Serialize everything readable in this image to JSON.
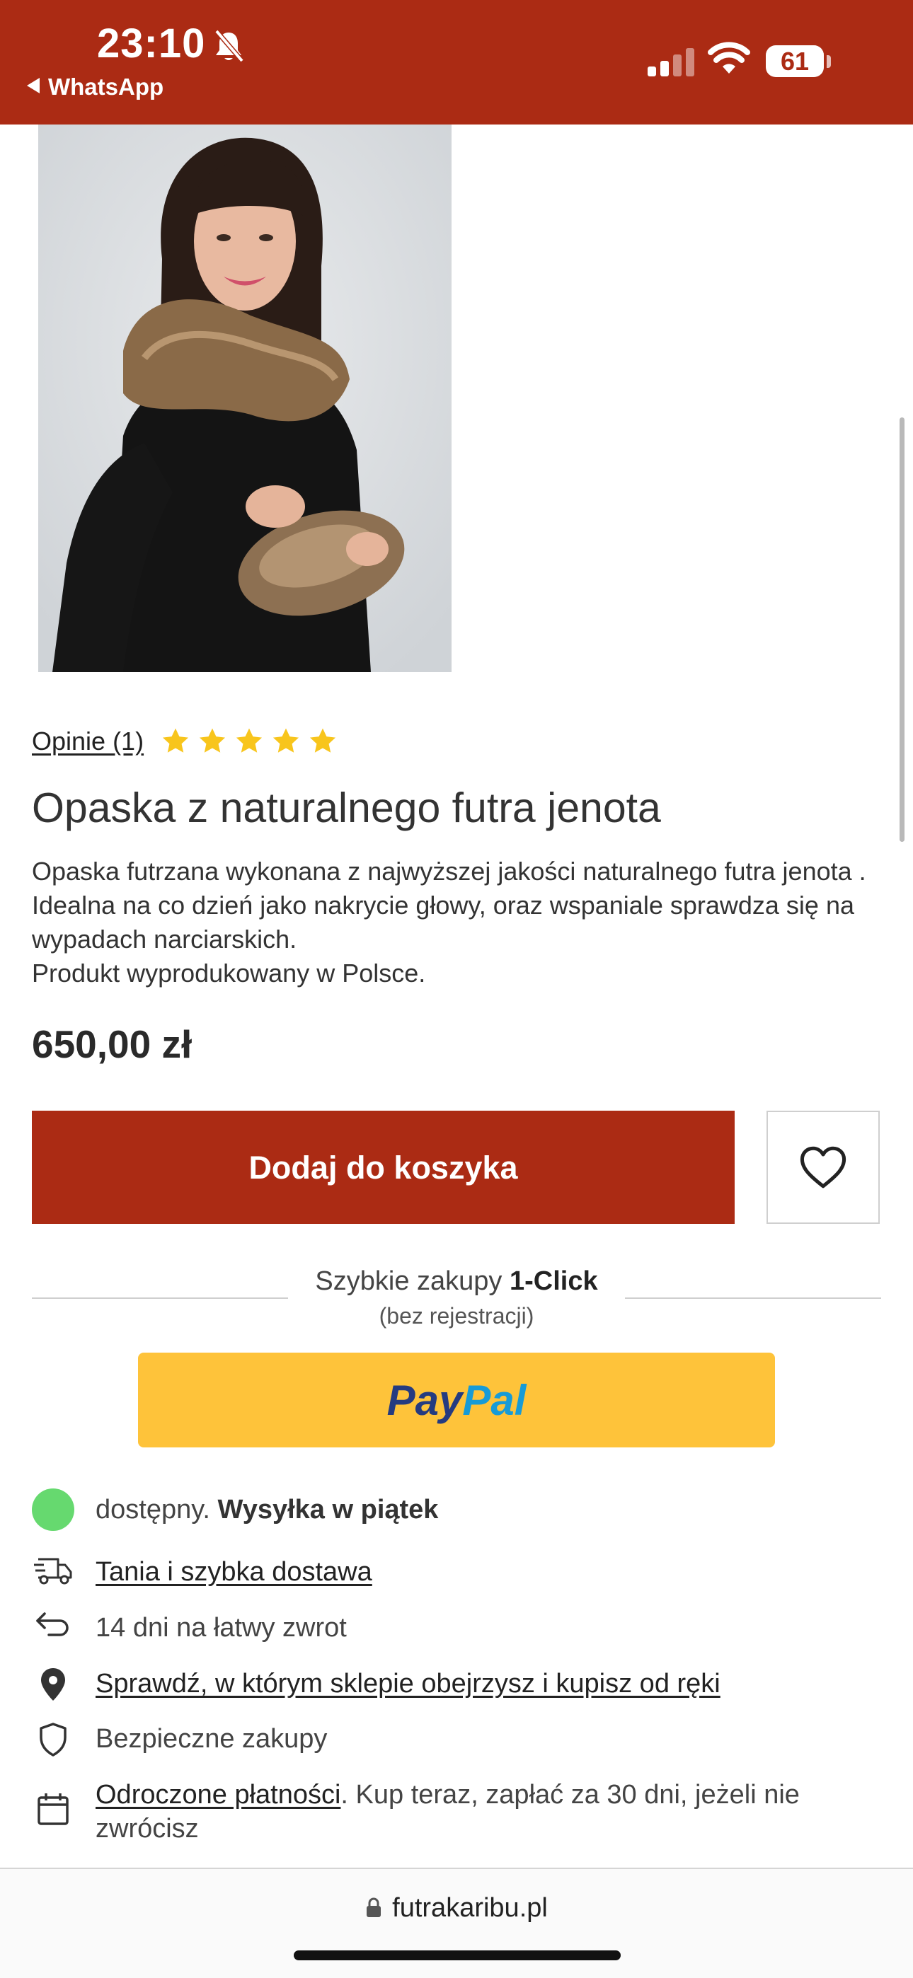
{
  "status_bar": {
    "time": "23:10",
    "back_app": "WhatsApp",
    "battery": "61",
    "background_color": "#ab2b14"
  },
  "product": {
    "reviews_label": "Opinie (1)",
    "rating": 5,
    "rating_max": 5,
    "title": "Opaska z naturalnego futra jenota",
    "description_lines": [
      "Opaska futrzana wykonana z najwyższej jakości naturalnego futra jenota . Idealna na co dzień jako nakrycie głowy, oraz wspaniale sprawdza się na wypadach narciarskich.",
      "Produkt wyprodukowany w Polsce."
    ],
    "price": "650,00 zł"
  },
  "actions": {
    "add_to_cart_label": "Dodaj do koszyka",
    "wishlist_icon": "heart-icon"
  },
  "quick_buy": {
    "title_prefix": "Szybkie zakupy ",
    "title_strong": "1-Click",
    "subtitle": "(bez rejestracji)",
    "paypal_part1": "Pay",
    "paypal_part2": "Pal"
  },
  "info": {
    "availability": "dostępny.",
    "shipping": " Wysyłka w piątek",
    "delivery_link": "Tania i szybka dostawa",
    "returns": "14 dni na łatwy zwrot",
    "store_link": "Sprawdź, w którym sklepie obejrzysz i kupisz od ręki",
    "secure": "Bezpieczne zakupy",
    "deferred_link": "Odroczone płatności",
    "deferred_text": ". Kup teraz, zapłać za 30 dni, jeżeli nie zwrócisz"
  },
  "browser": {
    "url": "futrakaribu.pl"
  },
  "colors": {
    "accent": "#ab2b14",
    "paypal_button": "#fec33a",
    "available_dot": "#66d96f",
    "star": "#f8c51c"
  }
}
